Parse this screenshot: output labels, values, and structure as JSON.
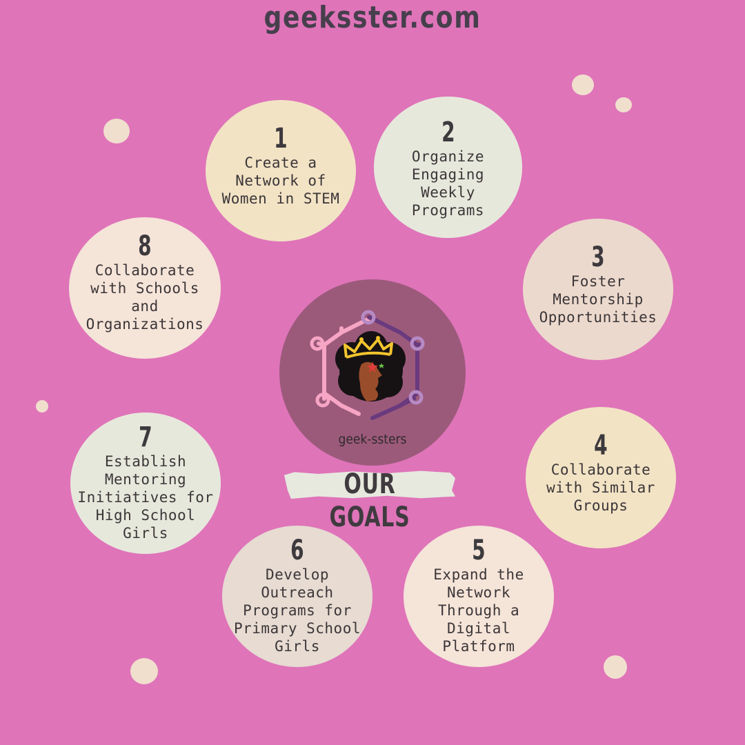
{
  "header": {
    "site": "geeksster.com"
  },
  "center": {
    "brand": "geek-ssters",
    "banner": "OUR GOALS"
  },
  "goals": [
    {
      "num": "1",
      "text": "Create a\nNetwork of\nWomen in STEM"
    },
    {
      "num": "2",
      "text": "Organize\nEngaging\nWeekly\nPrograms"
    },
    {
      "num": "3",
      "text": "Foster\nMentorship\nOpportunities"
    },
    {
      "num": "4",
      "text": "Collaborate\nwith Similar\nGroups"
    },
    {
      "num": "5",
      "text": "Expand the\nNetwork\nThrough a\nDigital\nPlatform"
    },
    {
      "num": "6",
      "text": "Develop\nOutreach\nPrograms for\nPrimary School\nGirls"
    },
    {
      "num": "7",
      "text": "Establish\nMentoring\nInitiatives for\nHigh School\nGirls"
    },
    {
      "num": "8",
      "text": "Collaborate\nwith Schools\nand\nOrganizations"
    }
  ],
  "colors": {
    "background": "#df74b9",
    "center": "#9c5a7b",
    "cream": "#f2e3c5",
    "sage": "#e7e8dc",
    "blush": "#f5e4d8",
    "hexagon_pink": "#f7a5c4",
    "hexagon_purple": "#6a3a7e"
  }
}
